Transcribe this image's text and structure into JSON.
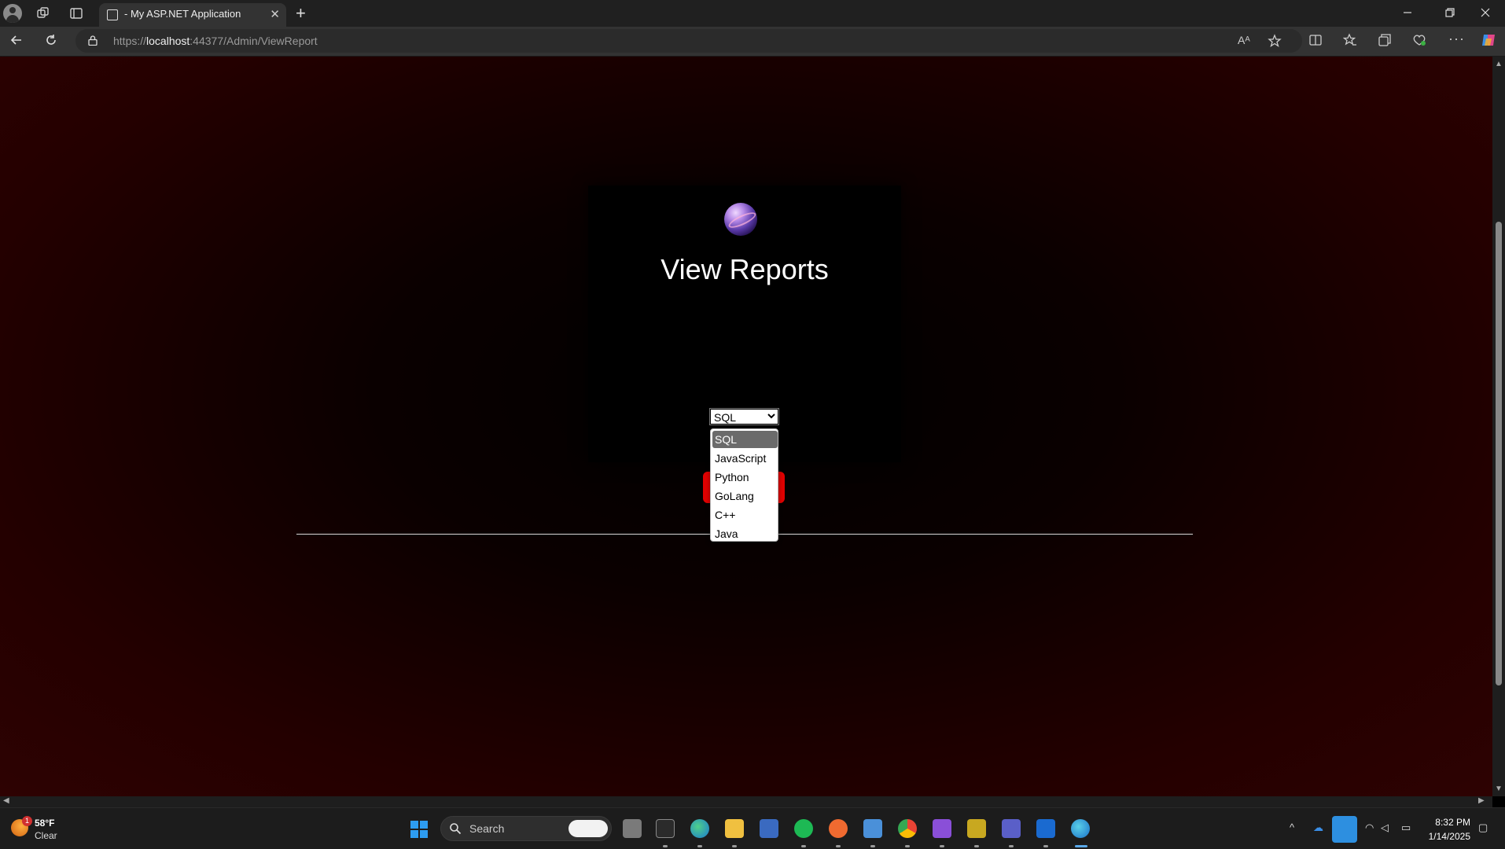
{
  "browser": {
    "tab_title": "- My ASP.NET Application",
    "tab_close": "✕",
    "new_tab": "+",
    "url_scheme": "https://",
    "url_host": "localhost",
    "url_rest": ":44377/Admin/ViewReport"
  },
  "page": {
    "title": "View Reports",
    "select": {
      "value": "SQL",
      "options": [
        "SQL",
        "JavaScript",
        "Python",
        "GoLang",
        "C++",
        "Java"
      ],
      "highlighted_index": 0
    }
  },
  "taskbar": {
    "weather_temp": "58°F",
    "weather_condition": "Clear",
    "weather_badge": "1",
    "search_label": "Search",
    "time": "8:32 PM",
    "date": "1/14/2025"
  },
  "colors": {
    "page_gradient_edge": "#2e0202",
    "button_red": "#e00000",
    "dropdown_highlight": "#6b6b6b",
    "accent_blue": "#2d8fe0"
  }
}
